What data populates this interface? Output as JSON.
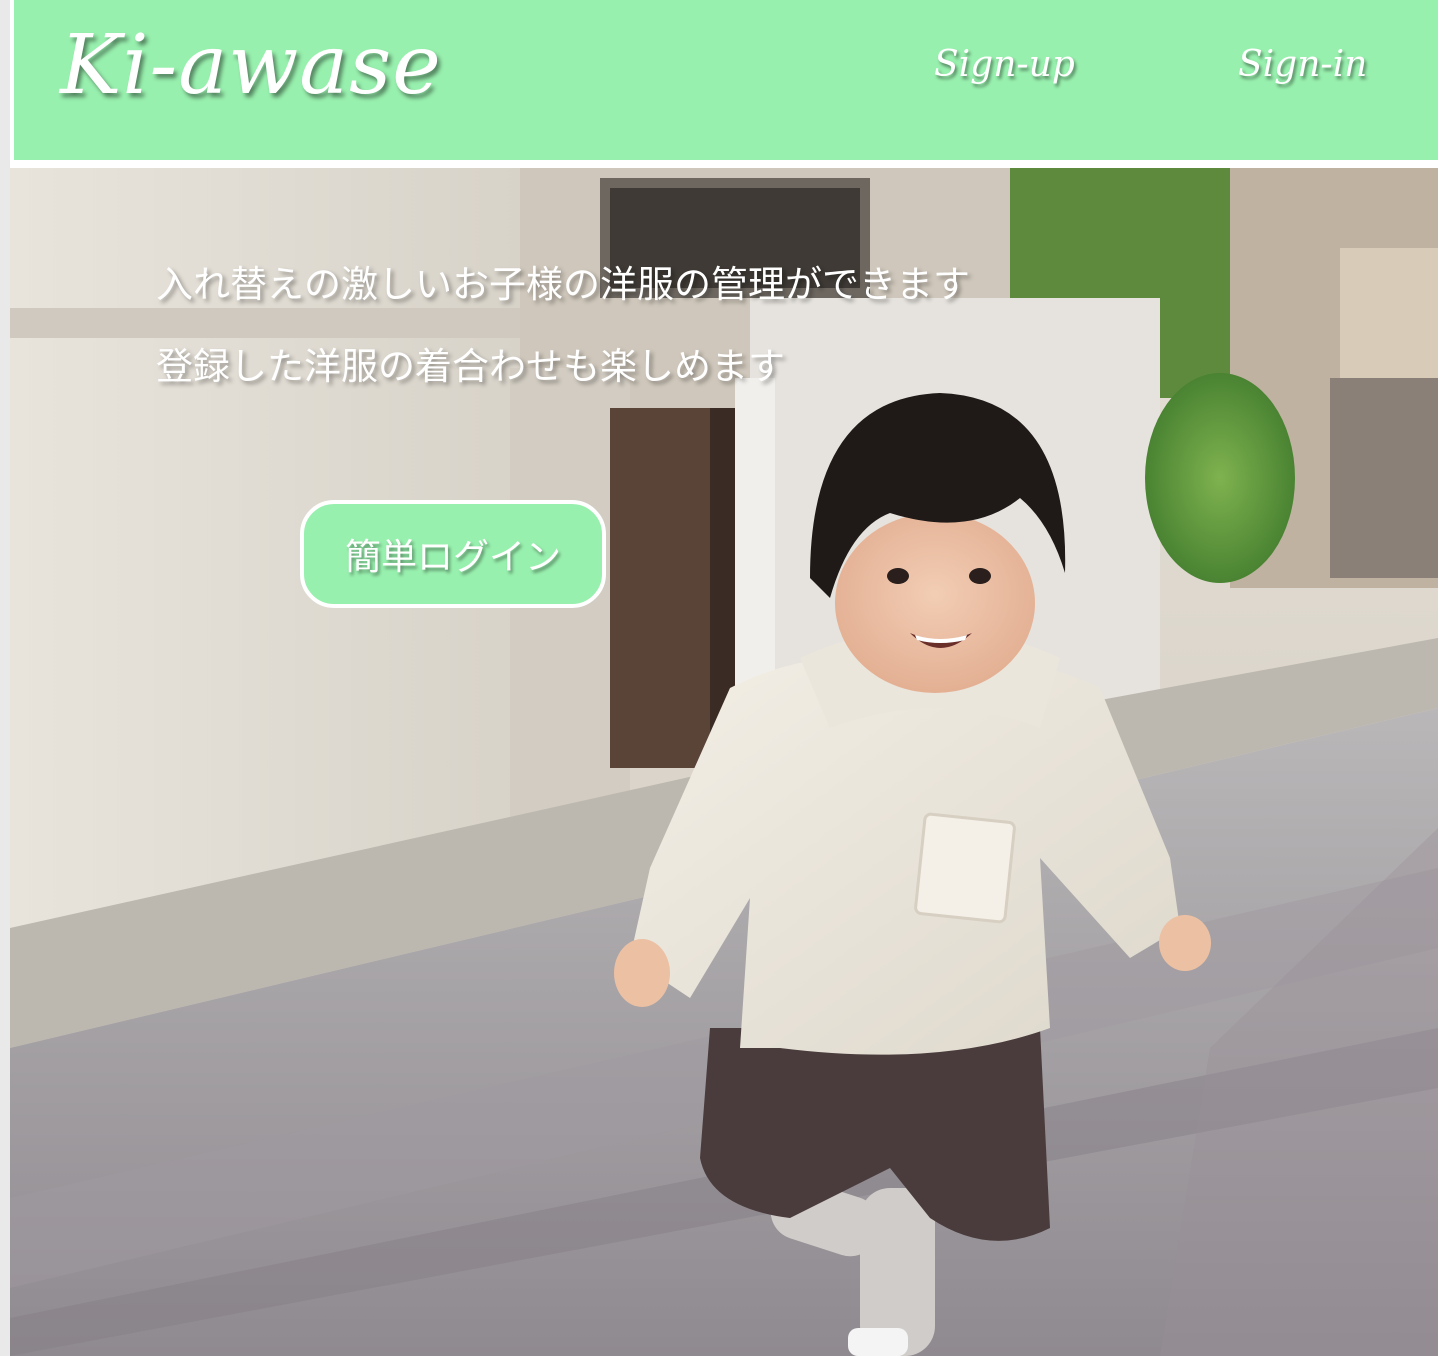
{
  "header": {
    "logo": "Ki-awase",
    "nav": {
      "signup_label": "Sign-up",
      "signin_label": "Sign-in"
    }
  },
  "hero": {
    "tagline_1": "入れ替えの激しいお子様の洋服の管理ができます",
    "tagline_2": "登録した洋服の着合わせも楽しめます",
    "guest_login_label": "簡単ログイン",
    "photo_description": "child-running-on-street-photo"
  },
  "colors": {
    "accent": "#98f0ae",
    "text_on_accent": "#ffffff"
  }
}
